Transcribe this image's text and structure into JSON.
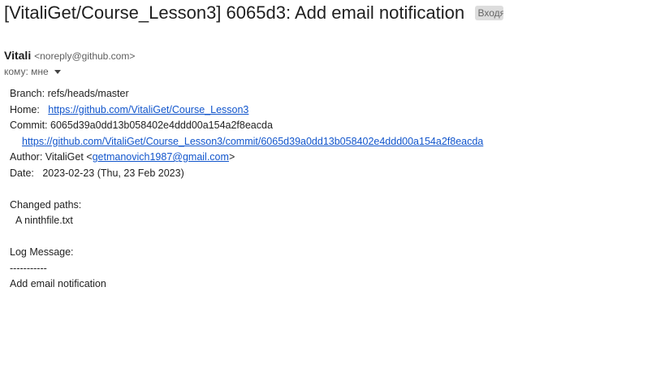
{
  "email": {
    "subject": "[VitaliGet/Course_Lesson3] 6065d3: Add email notification",
    "label_chip": "Входящие",
    "sender_name": "Vitali",
    "sender_email": "<noreply@github.com>",
    "to_line": "кому: мне"
  },
  "body": {
    "branch_label": "Branch:",
    "branch_value": "refs/heads/master",
    "home_label": "Home:",
    "home_link": "https://github.com/VitaliGet/Course_Lesson3",
    "commit_label": "Commit:",
    "commit_hash": "6065d39a0dd13b058402e4ddd00a154a2f8eacda",
    "commit_link": "https://github.com/VitaliGet/Course_Lesson3/commit/6065d39a0dd13b058402e4ddd00a154a2f8eacda",
    "author_label": "Author:",
    "author_name": "VitaliGet",
    "author_email": "getmanovich1987@gmail.com",
    "date_label": "Date:",
    "date_value": "2023-02-23 (Thu, 23 Feb 2023)",
    "changed_paths_label": "Changed paths:",
    "changed_file": "A ninthfile.txt",
    "log_message_label": "Log Message:",
    "separator": "-----------",
    "log_message": "Add email notification"
  }
}
